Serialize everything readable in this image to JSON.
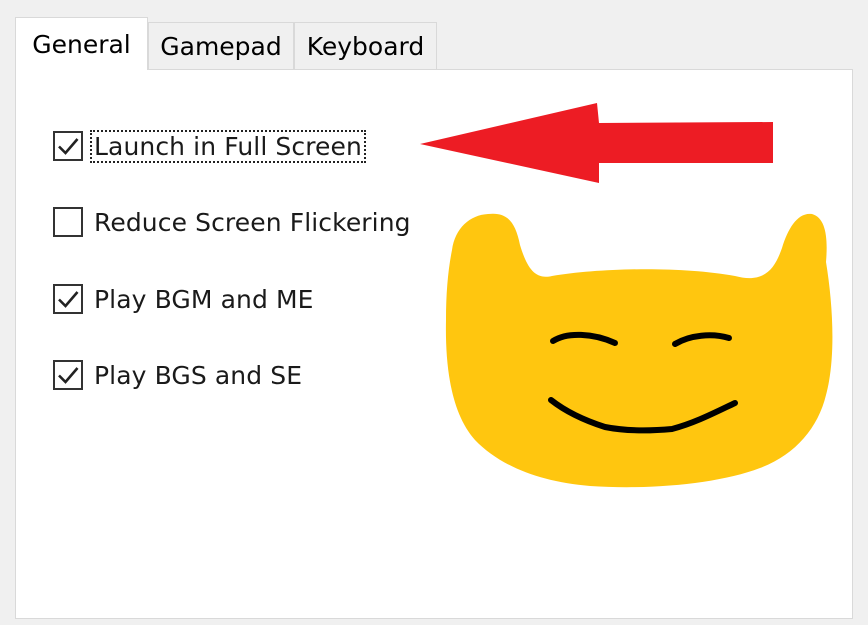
{
  "tabs": [
    {
      "label": "General",
      "active": true
    },
    {
      "label": "Gamepad",
      "active": false
    },
    {
      "label": "Keyboard",
      "active": false
    }
  ],
  "options": [
    {
      "label": "Launch in Full Screen",
      "checked": true,
      "focused": true
    },
    {
      "label": "Reduce Screen Flickering",
      "checked": false,
      "focused": false
    },
    {
      "label": "Play BGM and ME",
      "checked": true,
      "focused": false
    },
    {
      "label": "Play BGS and SE",
      "checked": true,
      "focused": false
    }
  ],
  "annotations": {
    "arrow": {
      "color": "#ed1c24",
      "icon": "red-arrow-pointing-left"
    },
    "face": {
      "color": "#ffc60f",
      "icon": "smiling-cat-face-doodle"
    }
  }
}
